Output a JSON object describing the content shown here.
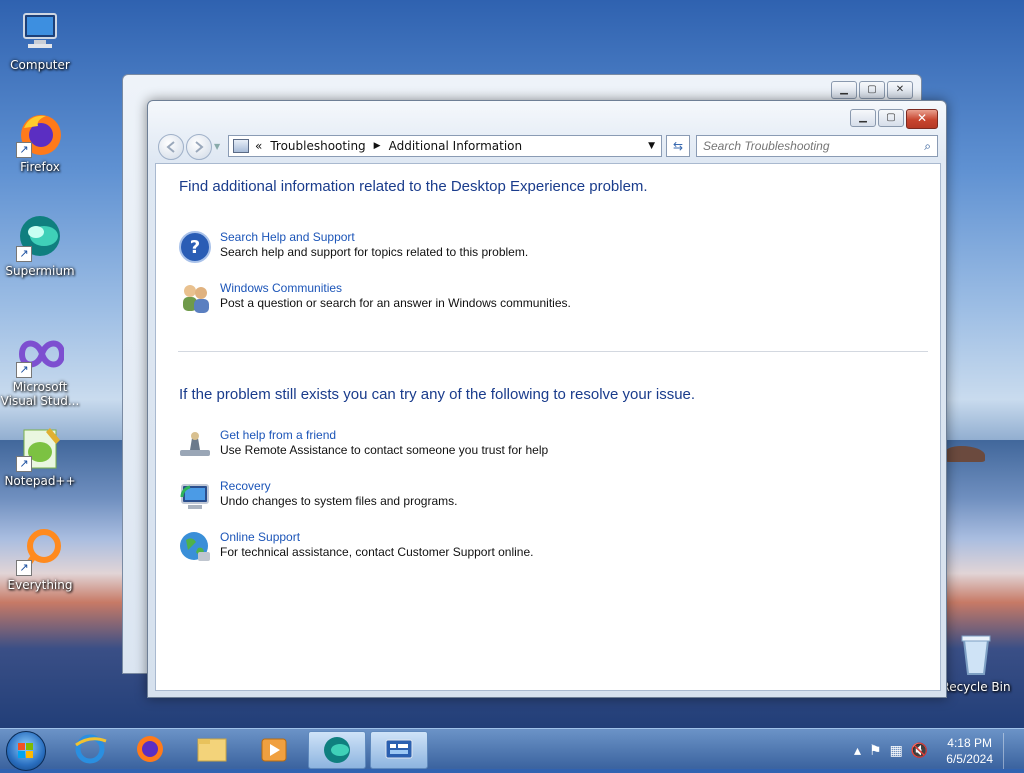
{
  "desktop": {
    "icons": [
      {
        "label": "Computer"
      },
      {
        "label": "Firefox"
      },
      {
        "label": "Supermium"
      },
      {
        "label": "Microsoft Visual Stud..."
      },
      {
        "label": "Notepad++"
      },
      {
        "label": "Everything"
      },
      {
        "label": "Recycle Bin"
      }
    ]
  },
  "window": {
    "address": {
      "overflow": "«",
      "crumbs": [
        "Troubleshooting",
        "Additional Information"
      ]
    },
    "search_placeholder": "Search Troubleshooting",
    "section1_heading": "Find additional information related to the Desktop Experience problem.",
    "section1_tasks": [
      {
        "title": "Search Help and Support",
        "desc": "Search help and support for topics related to this problem.",
        "icon": "help-icon"
      },
      {
        "title": "Windows Communities",
        "desc": "Post a question or search for an answer in Windows communities.",
        "icon": "people-icon"
      }
    ],
    "section2_heading": "If the problem still exists you can try any of the following to resolve your issue.",
    "section2_tasks": [
      {
        "title": "Get help from a friend",
        "desc": "Use Remote Assistance to contact someone you trust for help",
        "icon": "remote-assistance-icon"
      },
      {
        "title": "Recovery",
        "desc": "Undo changes to system files and programs.",
        "icon": "recovery-icon"
      },
      {
        "title": "Online Support",
        "desc": "For technical assistance, contact Customer Support online.",
        "icon": "globe-icon"
      }
    ]
  },
  "taskbar": {
    "clock_time": "4:18 PM",
    "clock_date": "6/5/2024"
  }
}
